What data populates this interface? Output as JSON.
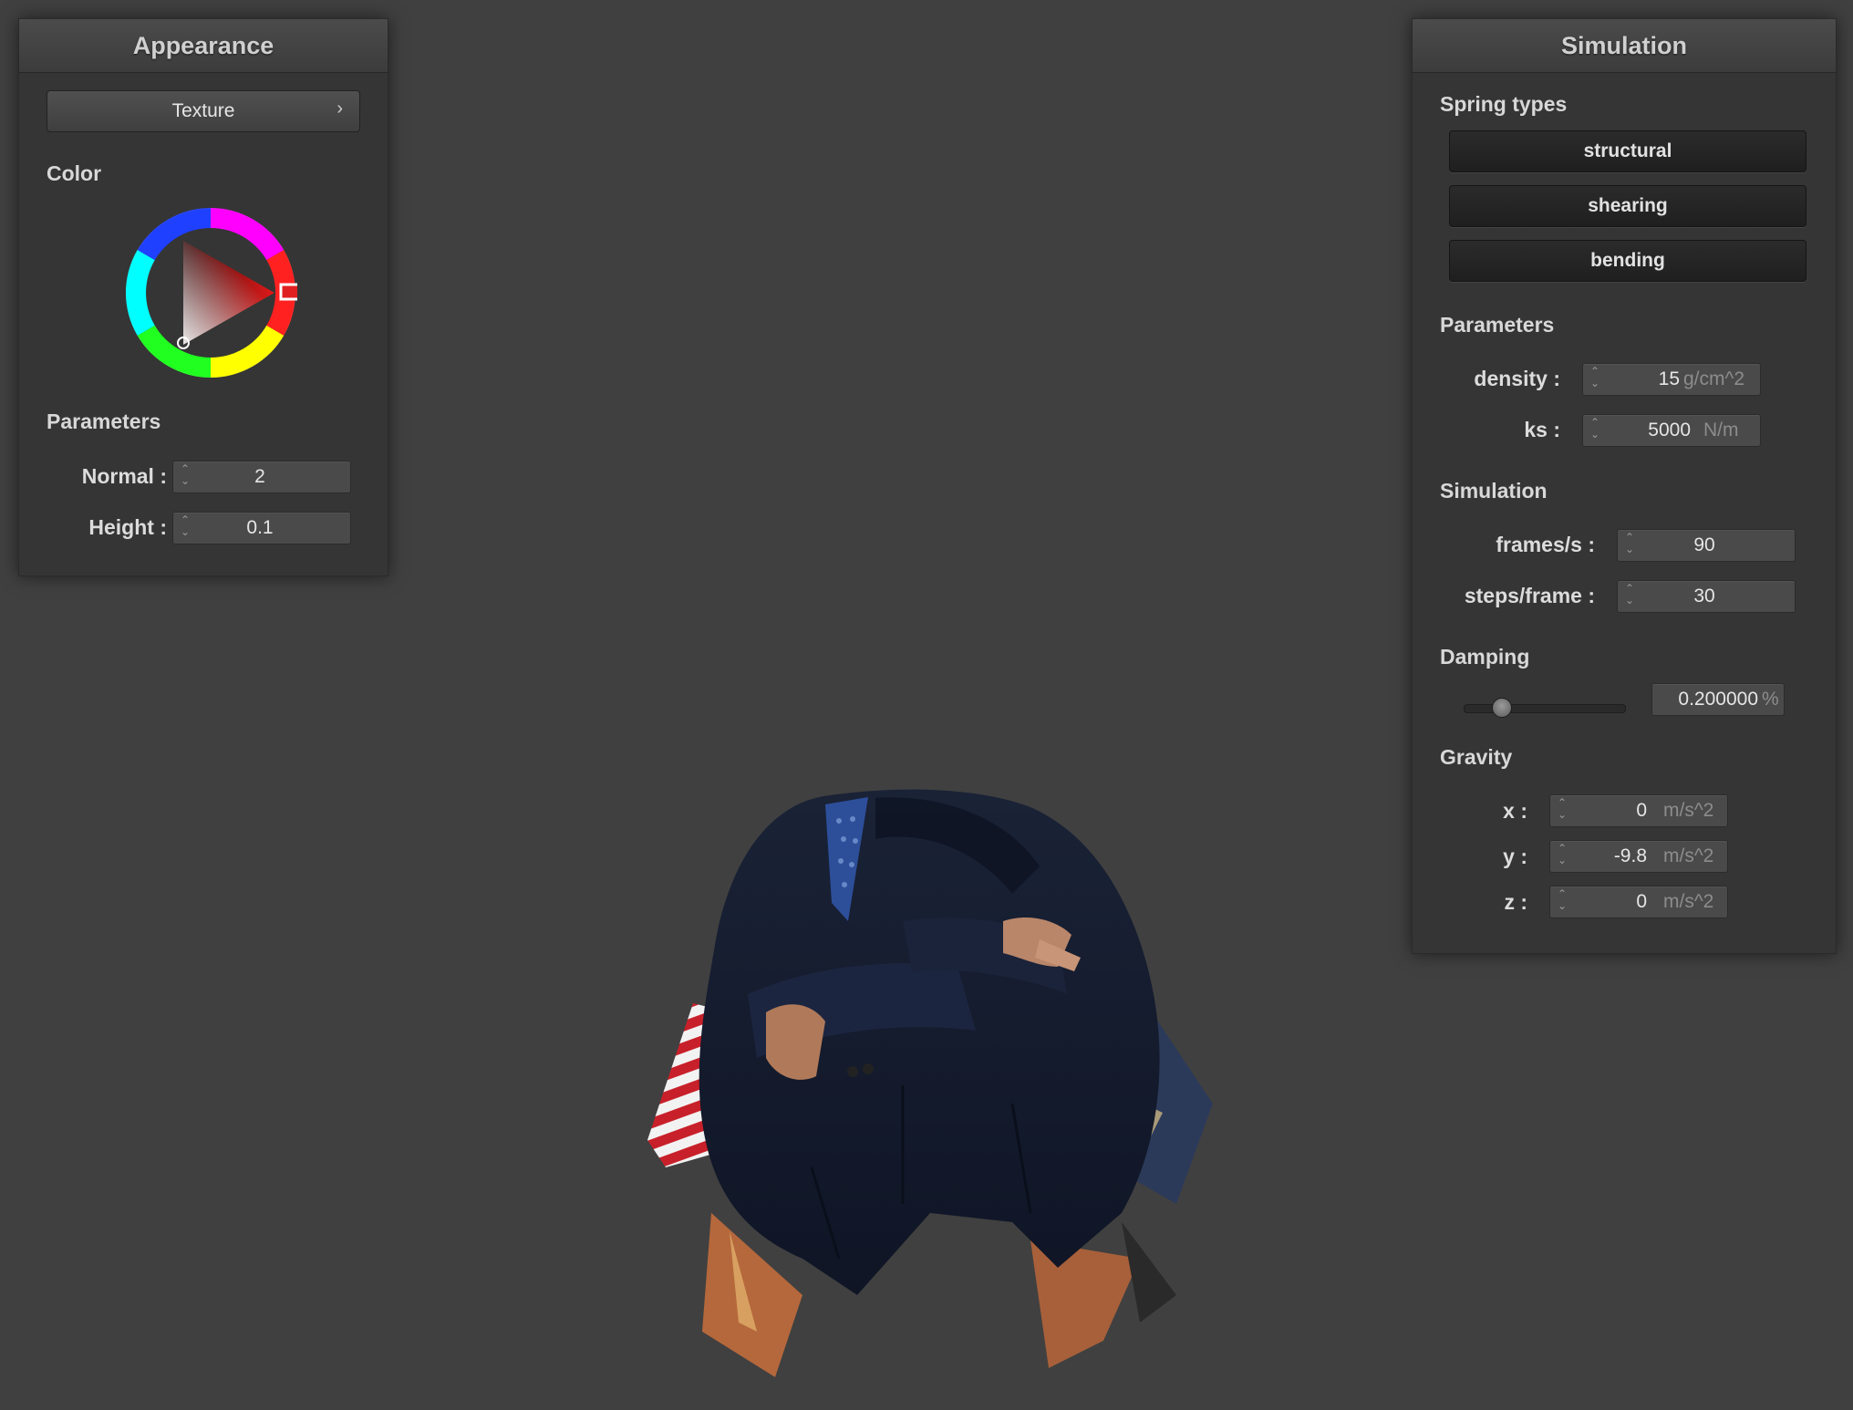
{
  "appearance": {
    "title": "Appearance",
    "texture_button": "Texture",
    "color_label": "Color",
    "parameters_label": "Parameters",
    "normal_label": "Normal :",
    "normal_value": "2",
    "height_label": "Height :",
    "height_value": "0.1",
    "selected_color": "#e02020"
  },
  "simulation": {
    "title": "Simulation",
    "spring_types_label": "Spring types",
    "spring_types": [
      "structural",
      "shearing",
      "bending"
    ],
    "parameters_label": "Parameters",
    "density_label": "density :",
    "density_value": "15",
    "density_unit": "g/cm^2",
    "ks_label": "ks :",
    "ks_value": "5000",
    "ks_unit": "N/m",
    "simulation_label": "Simulation",
    "fps_label": "frames/s :",
    "fps_value": "90",
    "steps_label": "steps/frame :",
    "steps_value": "30",
    "damping_label": "Damping",
    "damping_value": "0.200000",
    "damping_unit": "%",
    "damping_fraction": 0.2,
    "gravity_label": "Gravity",
    "gx_label": "x :",
    "gx_value": "0",
    "gy_label": "y :",
    "gy_value": "-9.8",
    "gz_label": "z :",
    "gz_value": "0",
    "gravity_unit": "m/s^2"
  }
}
